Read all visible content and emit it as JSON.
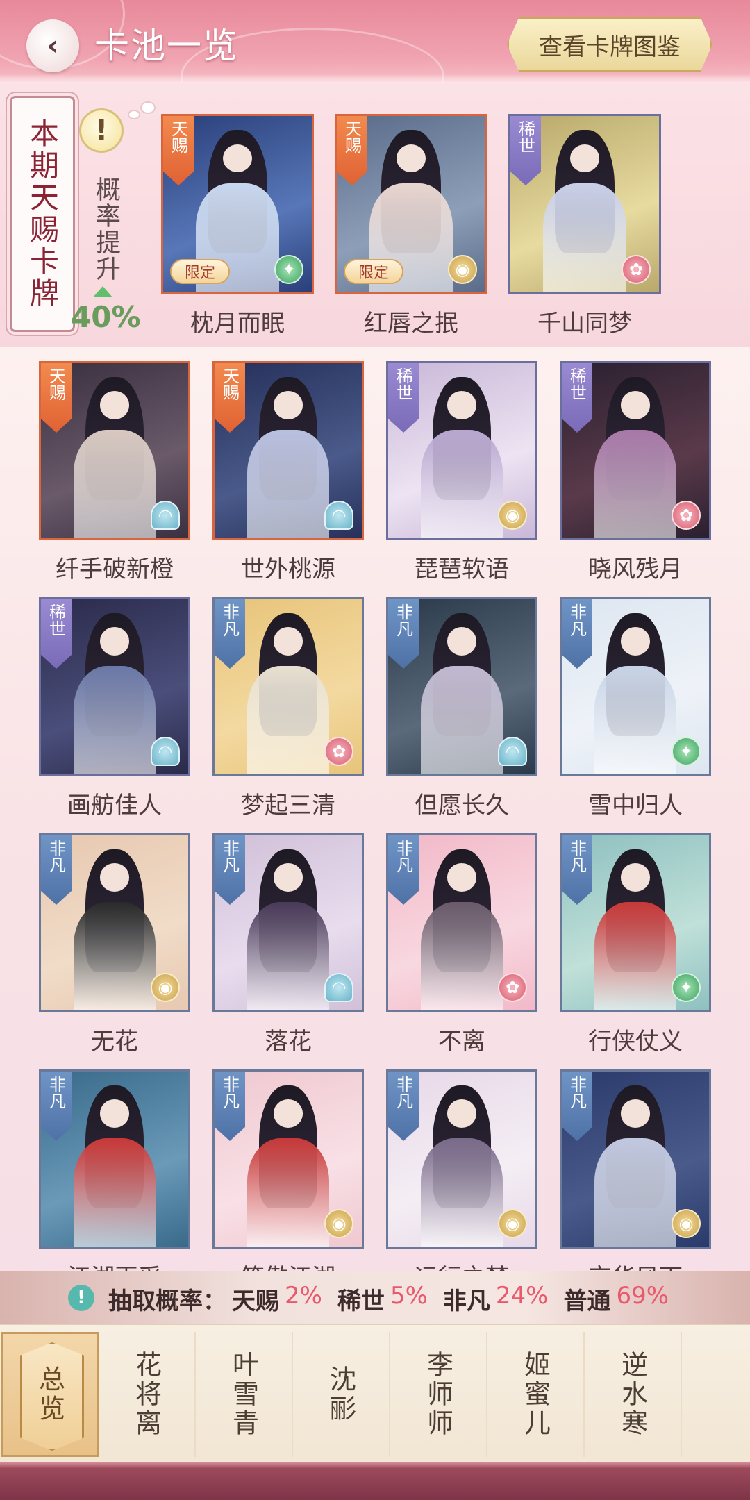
{
  "header": {
    "title": "卡池一览",
    "catalog_button": "查看卡牌图鉴"
  },
  "featured": {
    "label": "本期天赐卡牌",
    "rate_text": "概率提升",
    "rate_value": "40%",
    "cards": [
      {
        "name": "枕月而眠",
        "rarity": "天赐",
        "limited": "限定",
        "emblem": "green"
      },
      {
        "name": "红唇之抿",
        "rarity": "天赐",
        "limited": "限定",
        "emblem": "gold"
      },
      {
        "name": "千山同梦",
        "rarity": "稀世",
        "limited": null,
        "emblem": "red"
      }
    ]
  },
  "cards": [
    {
      "name": "纤手破新橙",
      "rarity": "天赐",
      "emblem": "fan"
    },
    {
      "name": "世外桃源",
      "rarity": "天赐",
      "emblem": "fan"
    },
    {
      "name": "琵琶软语",
      "rarity": "稀世",
      "emblem": "gold"
    },
    {
      "name": "晓风残月",
      "rarity": "稀世",
      "emblem": "red"
    },
    {
      "name": "画舫佳人",
      "rarity": "稀世",
      "emblem": "fan"
    },
    {
      "name": "梦起三清",
      "rarity": "非凡",
      "emblem": "red"
    },
    {
      "name": "但愿长久",
      "rarity": "非凡",
      "emblem": "fan"
    },
    {
      "name": "雪中归人",
      "rarity": "非凡",
      "emblem": "green"
    },
    {
      "name": "无花",
      "rarity": "非凡",
      "emblem": "gold"
    },
    {
      "name": "落花",
      "rarity": "非凡",
      "emblem": "fan"
    },
    {
      "name": "不离",
      "rarity": "非凡",
      "emblem": "red"
    },
    {
      "name": "行侠仗义",
      "rarity": "非凡",
      "emblem": "green"
    },
    {
      "name": "江湖再采",
      "rarity": "非凡",
      "emblem": "none"
    },
    {
      "name": "笑傲江湖",
      "rarity": "非凡",
      "emblem": "gold"
    },
    {
      "name": "远行之梦",
      "rarity": "非凡",
      "emblem": "gold"
    },
    {
      "name": "京华风雨",
      "rarity": "非凡",
      "emblem": "gold"
    }
  ],
  "probability": {
    "prefix": "抽取概率：",
    "items": [
      {
        "label": "天赐",
        "value": "2%"
      },
      {
        "label": "稀世",
        "value": "5%"
      },
      {
        "label": "非凡",
        "value": "24%"
      },
      {
        "label": "普通",
        "value": "69%"
      }
    ]
  },
  "tabs": [
    {
      "label": "总览",
      "active": true
    },
    {
      "label": "花将离",
      "active": false
    },
    {
      "label": "叶雪青",
      "active": false
    },
    {
      "label": "沈彨",
      "active": false
    },
    {
      "label": "李师师",
      "active": false
    },
    {
      "label": "姬蜜儿",
      "active": false
    },
    {
      "label": "逆水寒",
      "active": false
    }
  ],
  "colors": {
    "accent": "#e8899a",
    "tianci": "#e06234",
    "xishi": "#7a6bb8",
    "feifan": "#4f72a6",
    "percent": "#e8596e"
  }
}
